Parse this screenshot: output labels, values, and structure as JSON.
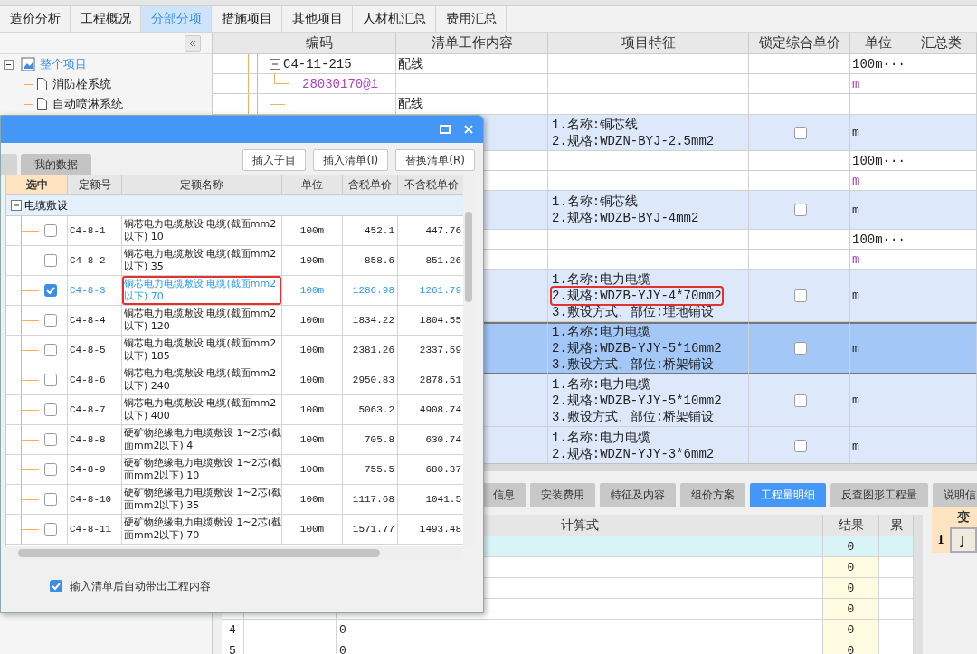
{
  "top_tabs": [
    {
      "label": "造价分析",
      "selected": false
    },
    {
      "label": "工程概况",
      "selected": false
    },
    {
      "label": "分部分项",
      "selected": true
    },
    {
      "label": "措施项目",
      "selected": false
    },
    {
      "label": "其他项目",
      "selected": false
    },
    {
      "label": "人材机汇总",
      "selected": false
    },
    {
      "label": "费用汇总",
      "selected": false
    }
  ],
  "project_tree": {
    "label": "整个项目",
    "selected": true,
    "expanded": true,
    "children": [
      {
        "label": "消防栓系统",
        "selected": false
      },
      {
        "label": "自动喷淋系统",
        "selected": false
      }
    ]
  },
  "bill_grid": {
    "columns": [
      "编码",
      "清单工作内容",
      "项目特征",
      "锁定综合单价",
      "单位",
      "汇总类"
    ],
    "rows": [
      {
        "kind": "quota",
        "code": "C4-11-215",
        "expanded": true,
        "content": "配线",
        "unit": "100m···",
        "selected": false
      },
      {
        "kind": "material",
        "code": "28030170@1",
        "unit": "m",
        "selected": false
      },
      {
        "kind": "quota",
        "content": "配线",
        "selected": false
      },
      {
        "kind": "item",
        "features": [
          {
            "text": "1.名称:铜芯线",
            "highlighted": false
          },
          {
            "text": "2.规格:WDZN-BYJ-2.5mm2",
            "highlighted": false
          }
        ],
        "locked": false,
        "unit": "m",
        "selected": false
      },
      {
        "kind": "quota",
        "unit": "100m···",
        "selected": false
      },
      {
        "kind": "material",
        "unit": "m",
        "selected": false
      },
      {
        "kind": "item",
        "features": [
          {
            "text": "1.名称:铜芯线",
            "highlighted": false
          },
          {
            "text": "2.规格:WDZB-BYJ-4mm2",
            "highlighted": false
          }
        ],
        "locked": false,
        "unit": "m",
        "selected": false
      },
      {
        "kind": "quota",
        "unit": "100m···",
        "selected": false
      },
      {
        "kind": "material",
        "unit": "m",
        "selected": false
      },
      {
        "kind": "item",
        "features": [
          {
            "text": "1.名称:电力电缆",
            "highlighted": false
          },
          {
            "text": "2.规格:WDZB-YJY-4*70mm2",
            "highlighted": true
          },
          {
            "text": "3.敷设方式、部位:埋地铺设",
            "highlighted": false
          }
        ],
        "locked": false,
        "unit": "m",
        "selected": false
      },
      {
        "kind": "item",
        "features": [
          {
            "text": "1.名称:电力电缆",
            "highlighted": false
          },
          {
            "text": "2.规格:WDZB-YJY-5*16mm2",
            "highlighted": false
          },
          {
            "text": "3.敷设方式、部位:桥架铺设",
            "highlighted": false
          }
        ],
        "locked": false,
        "unit": "m",
        "selected": true
      },
      {
        "kind": "item",
        "features": [
          {
            "text": "1.名称:电力电缆",
            "highlighted": false
          },
          {
            "text": "2.规格:WDZB-YJY-5*10mm2",
            "highlighted": false
          },
          {
            "text": "3.敷设方式、部位:桥架铺设",
            "highlighted": false
          }
        ],
        "locked": false,
        "unit": "m",
        "selected": false
      },
      {
        "kind": "item",
        "features": [
          {
            "text": "1.名称:电力电缆",
            "highlighted": false
          },
          {
            "text": "2.规格:WDZN-YJY-3*6mm2",
            "highlighted": false
          }
        ],
        "locked": false,
        "unit": "m",
        "selected": false
      }
    ]
  },
  "quota_dialog": {
    "tabs": [
      {
        "label": "我的数据",
        "selected": false
      }
    ],
    "buttons": [
      "插入子目",
      "插入清单(I)",
      "替换清单(R)"
    ],
    "columns": [
      "选中",
      "定额号",
      "定额名称",
      "单位",
      "含税单价",
      "不含税单价"
    ],
    "group": {
      "label": "电缆敷设",
      "expanded": true
    },
    "rows": [
      {
        "code": "C4-8-1",
        "name": "铜芯电力电缆敷设 电缆(截面mm2以下) 10",
        "unit": "100m",
        "price_tax": "452.1",
        "price": "447.76",
        "checked": false,
        "selected": false,
        "highlighted": false
      },
      {
        "code": "C4-8-2",
        "name": "铜芯电力电缆敷设 电缆(截面mm2以下) 35",
        "unit": "100m",
        "price_tax": "858.6",
        "price": "851.26",
        "checked": false,
        "selected": false,
        "highlighted": false
      },
      {
        "code": "C4-8-3",
        "name": "铜芯电力电缆敷设 电缆(截面mm2以下) 70",
        "unit": "100m",
        "price_tax": "1286.98",
        "price": "1261.79",
        "checked": true,
        "selected": true,
        "highlighted": true
      },
      {
        "code": "C4-8-4",
        "name": "铜芯电力电缆敷设 电缆(截面mm2以下) 120",
        "unit": "100m",
        "price_tax": "1834.22",
        "price": "1804.55",
        "checked": false,
        "selected": false,
        "highlighted": false
      },
      {
        "code": "C4-8-5",
        "name": "铜芯电力电缆敷设 电缆(截面mm2以下) 185",
        "unit": "100m",
        "price_tax": "2381.26",
        "price": "2337.59",
        "checked": false,
        "selected": false,
        "highlighted": false
      },
      {
        "code": "C4-8-6",
        "name": "铜芯电力电缆敷设 电缆(截面mm2以下) 240",
        "unit": "100m",
        "price_tax": "2950.83",
        "price": "2878.51",
        "checked": false,
        "selected": false,
        "highlighted": false
      },
      {
        "code": "C4-8-7",
        "name": "铜芯电力电缆敷设 电缆(截面mm2以下) 400",
        "unit": "100m",
        "price_tax": "5063.2",
        "price": "4908.74",
        "checked": false,
        "selected": false,
        "highlighted": false
      },
      {
        "code": "C4-8-8",
        "name": "硬矿物绝缘电力电缆敷设 1~2芯(截面mm2以下) 4",
        "unit": "100m",
        "price_tax": "705.8",
        "price": "630.74",
        "checked": false,
        "selected": false,
        "highlighted": false
      },
      {
        "code": "C4-8-9",
        "name": "硬矿物绝缘电力电缆敷设 1~2芯(截面mm2以下) 10",
        "unit": "100m",
        "price_tax": "755.5",
        "price": "680.37",
        "checked": false,
        "selected": false,
        "highlighted": false
      },
      {
        "code": "C4-8-10",
        "name": "硬矿物绝缘电力电缆敷设 1~2芯(截面mm2以下) 35",
        "unit": "100m",
        "price_tax": "1117.68",
        "price": "1041.5",
        "checked": false,
        "selected": false,
        "highlighted": false
      },
      {
        "code": "C4-8-11",
        "name": "硬矿物绝缘电力电缆敷设 1~2芯(截面mm2以下) 70",
        "unit": "100m",
        "price_tax": "1571.77",
        "price": "1493.48",
        "checked": false,
        "selected": false,
        "highlighted": false
      }
    ],
    "auto_fill": {
      "label": "输入清单后自动带出工程内容",
      "checked": true
    }
  },
  "detail_panel": {
    "tabs": [
      {
        "label": "信息",
        "selected": false
      },
      {
        "label": "安装费用",
        "selected": false
      },
      {
        "label": "特征及内容",
        "selected": false
      },
      {
        "label": "组价方案",
        "selected": false
      },
      {
        "label": "工程量明细",
        "selected": true
      },
      {
        "label": "反查图形工程量",
        "selected": false
      },
      {
        "label": "说明信",
        "selected": false
      }
    ],
    "columns": [
      "计算式",
      "结果",
      "累"
    ],
    "rows": [
      {
        "result": "0",
        "selected": true
      },
      {
        "result": "0",
        "selected": false
      },
      {
        "result": "0",
        "selected": false
      },
      {
        "result": "0",
        "selected": false
      },
      {
        "number": "4",
        "formula": "0",
        "result": "0",
        "selected": false
      },
      {
        "number": "5",
        "formula": "0",
        "result": "0",
        "selected": false
      }
    ],
    "variables": {
      "header": "变",
      "rows": [
        {
          "number": "1",
          "value": "J"
        }
      ]
    }
  }
}
